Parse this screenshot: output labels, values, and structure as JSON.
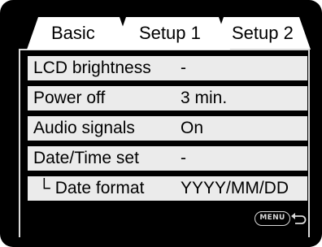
{
  "tabs": [
    {
      "label": "Basic",
      "active": true
    },
    {
      "label": "Setup 1",
      "active": false
    },
    {
      "label": "Setup 2",
      "active": false
    }
  ],
  "menu": {
    "rows": [
      {
        "label": "LCD brightness",
        "value": "-"
      },
      {
        "label": "Power off",
        "value": "3 min."
      },
      {
        "label": "Audio signals",
        "value": "On"
      },
      {
        "label": "Date/Time set",
        "value": "-"
      },
      {
        "label": "└ Date format",
        "value": "YYYY/MM/DD"
      }
    ]
  },
  "footer": {
    "menu_button_label": "MENU",
    "back_icon": "return-arrow-icon"
  },
  "colors": {
    "screen_bg": "#000000",
    "tab_bg": "#ffffff",
    "row_bg": "#ebebeb",
    "text": "#000000",
    "border": "#d9d9d9"
  }
}
